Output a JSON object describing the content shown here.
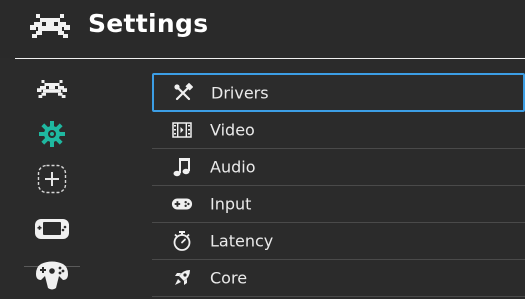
{
  "header": {
    "title": "Settings",
    "logo_icon": "retroarch-invader-icon"
  },
  "sidebar": {
    "items": [
      {
        "icon": "retroarch-invader-icon"
      },
      {
        "icon": "gear-icon",
        "color": "#1fb8a0"
      },
      {
        "icon": "add-content-icon"
      },
      {
        "icon": "handheld-console-icon"
      },
      {
        "icon": "n64-controller-icon"
      }
    ]
  },
  "menu": {
    "accent": "#3c9ee5",
    "items": [
      {
        "label": "Drivers",
        "icon": "tools-icon",
        "selected": true
      },
      {
        "label": "Video",
        "icon": "film-icon"
      },
      {
        "label": "Audio",
        "icon": "music-note-icon"
      },
      {
        "label": "Input",
        "icon": "gamepad-icon"
      },
      {
        "label": "Latency",
        "icon": "stopwatch-icon"
      },
      {
        "label": "Core",
        "icon": "rocket-icon"
      }
    ]
  }
}
